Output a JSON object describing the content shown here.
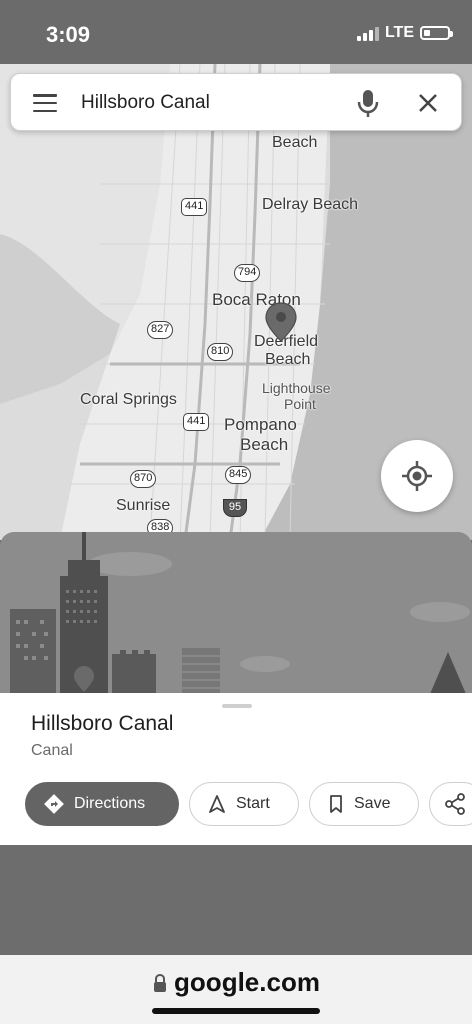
{
  "status_bar": {
    "time": "3:09",
    "network": "LTE"
  },
  "search": {
    "query": "Hillsboro Canal"
  },
  "map": {
    "labels": {
      "beach_top": "Beach",
      "delray": "Delray Beach",
      "boca": "Boca Raton",
      "deerfield_1": "Deerfield",
      "deerfield_2": "Beach",
      "lighthouse_1": "Lighthouse",
      "lighthouse_2": "Point",
      "coral": "Coral Springs",
      "pompano_1": "Pompano",
      "pompano_2": "Beach",
      "sunrise": "Sunrise"
    },
    "shields": {
      "us441_top": "441",
      "r794": "794",
      "r827": "827",
      "r810": "810",
      "us441_bottom": "441",
      "r870": "870",
      "r845": "845",
      "i95": "95",
      "r838": "838"
    }
  },
  "place": {
    "title": "Hillsboro Canal",
    "type": "Canal"
  },
  "actions": {
    "directions": "Directions",
    "start": "Start",
    "save": "Save"
  },
  "browser": {
    "url": "google.com"
  }
}
